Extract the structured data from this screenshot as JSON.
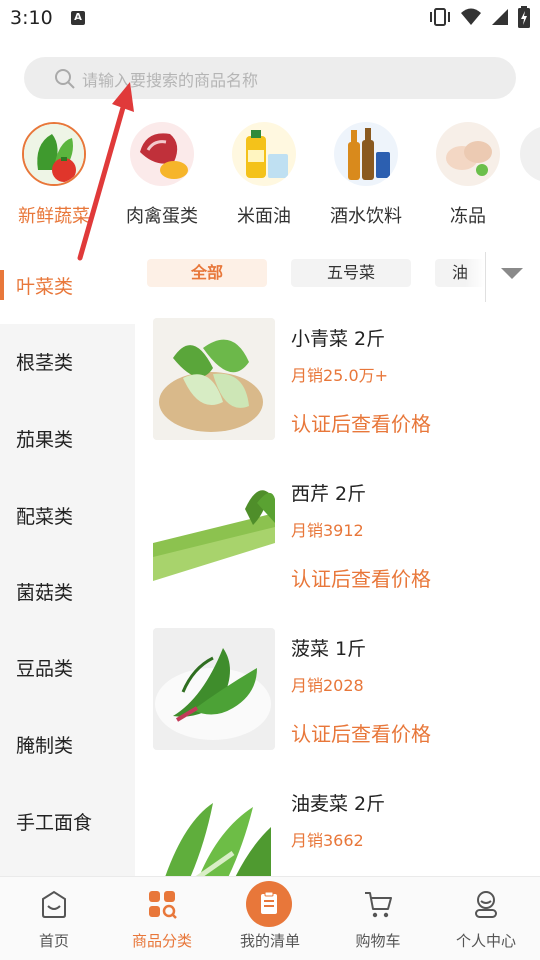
{
  "status_bar": {
    "time": "3:10",
    "notification_badge": "A"
  },
  "search": {
    "placeholder": "请输入要搜索的商品名称"
  },
  "categories": [
    {
      "label": "新鲜蔬菜",
      "active": true
    },
    {
      "label": "肉禽蛋类",
      "active": false
    },
    {
      "label": "米面油",
      "active": false
    },
    {
      "label": "酒水饮料",
      "active": false
    },
    {
      "label": "冻品",
      "active": false
    }
  ],
  "sidebar": {
    "items": [
      {
        "label": "叶菜类",
        "active": true
      },
      {
        "label": "根茎类",
        "active": false
      },
      {
        "label": "茄果类",
        "active": false
      },
      {
        "label": "配菜类",
        "active": false
      },
      {
        "label": "菌菇类",
        "active": false
      },
      {
        "label": "豆品类",
        "active": false
      },
      {
        "label": "腌制类",
        "active": false
      },
      {
        "label": "手工面食",
        "active": false
      }
    ]
  },
  "filter_chips": [
    {
      "label": "全部",
      "active": true
    },
    {
      "label": "五号菜",
      "active": false
    },
    {
      "label": "油",
      "active": false
    }
  ],
  "products": [
    {
      "name": "小青菜 2斤",
      "sales": "月销25.0万+",
      "price_text": "认证后查看价格"
    },
    {
      "name": "西芹 2斤",
      "sales": "月销3912",
      "price_text": "认证后查看价格"
    },
    {
      "name": "菠菜 1斤",
      "sales": "月销2028",
      "price_text": "认证后查看价格"
    },
    {
      "name": "油麦菜 2斤",
      "sales": "月销3662",
      "price_text": ""
    }
  ],
  "tabbar": {
    "items": [
      {
        "label": "首页",
        "icon": "home-icon",
        "active": false
      },
      {
        "label": "商品分类",
        "icon": "category-icon",
        "active": true
      },
      {
        "label": "我的清单",
        "icon": "clipboard-icon",
        "active": false
      },
      {
        "label": "购物车",
        "icon": "cart-icon",
        "active": false
      },
      {
        "label": "个人中心",
        "icon": "profile-icon",
        "active": false
      }
    ]
  },
  "colors": {
    "accent": "#e8773a",
    "annotation_arrow": "#e03a3a"
  }
}
